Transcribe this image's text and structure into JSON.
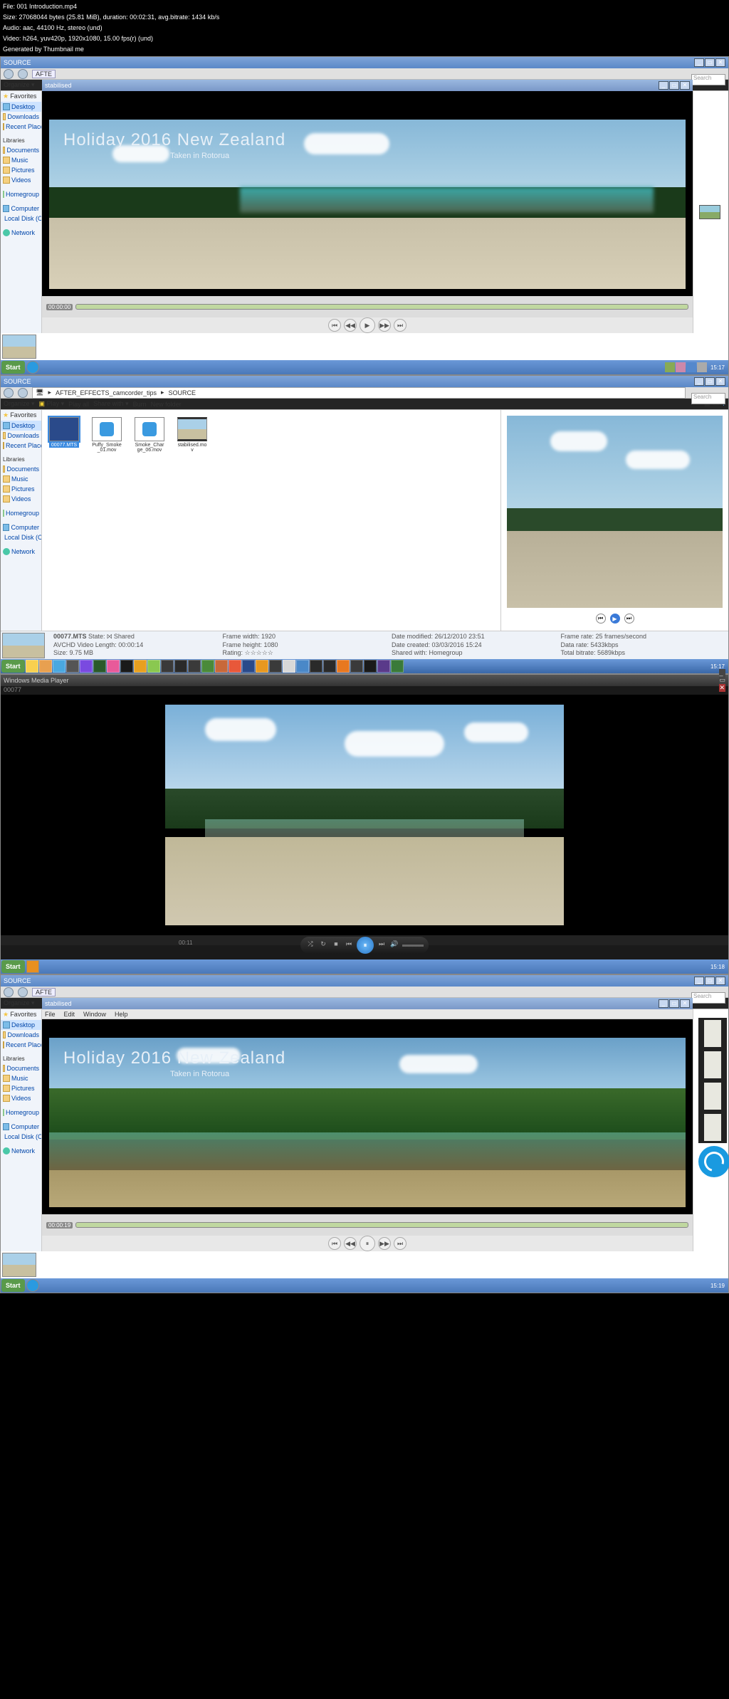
{
  "header": {
    "file": "File: 001 Introduction.mp4",
    "size": "Size: 27068044 bytes (25.81 MiB), duration: 00:02:31, avg.bitrate: 1434 kb/s",
    "audio": "Audio: aac, 44100 Hz, stereo (und)",
    "video": "Video: h264, yuv420p, 1920x1080, 15.00 fps(r) (und)",
    "gen": "Generated by Thumbnail me"
  },
  "sidebar": {
    "favorites": "Favorites",
    "desktop": "Desktop",
    "downloads": "Downloads",
    "recent": "Recent Places",
    "libraries": "Libraries",
    "documents": "Documents",
    "music": "Music",
    "pictures": "Pictures",
    "videos": "Videos",
    "homegroup": "Homegroup",
    "computer": "Computer",
    "localdisk": "Local Disk (C:)",
    "network": "Network"
  },
  "s1": {
    "title": "SOURCE",
    "stabtitle": "stabilised",
    "menu_file": "File",
    "menu_edit": "Edit",
    "menu_window": "Window",
    "menu_help": "Help",
    "afterbadge": "AFTE",
    "organize": "Organize ▾",
    "search": "Search",
    "video_title": "Holiday 2016 New Zealand",
    "video_sub": "Taken in Rotorua",
    "time": "00:00:00",
    "clock": "15:17",
    "start": "Start"
  },
  "s2": {
    "crumbs": [
      "AFTER_EFFECTS_camcorder_tips",
      "SOURCE"
    ],
    "organize": "Organize ▾",
    "play": "Play ▾",
    "playall": "Play all",
    "share": "Share with ▾",
    "burn": "Burn",
    "newfolder": "New folder",
    "files": [
      {
        "name": "00077.MTS",
        "sel": true
      },
      {
        "name": "Puffy_Smoke_01.mov",
        "sel": false
      },
      {
        "name": "Smoke_Charge_06.mov",
        "sel": false
      },
      {
        "name": "stabilised.mov",
        "sel": false
      }
    ],
    "details": {
      "name": "00077.MTS",
      "state": "State: ⨝ Shared",
      "type": "AVCHD Video",
      "length": "Length: 00:00:14",
      "size": "Size: 9.75 MB",
      "fw": "Frame width: 1920",
      "fh": "Frame height: 1080",
      "rating": "Rating:",
      "dm": "Date modified: 26/12/2010 23:51",
      "dc": "Date created: 03/03/2016 15:24",
      "sw": "Shared with: Homegroup",
      "fr": "Frame rate: 25 frames/second",
      "dr": "Data rate: 5433kbps",
      "tb": "Total bitrate: 5689kbps"
    },
    "clock": "15:17"
  },
  "s3": {
    "title": "Windows Media Player",
    "label": "00077",
    "time": "00:11",
    "clock": "15:18",
    "start": "Start"
  },
  "s4": {
    "video_title": "Holiday 2016 New Zealand",
    "video_sub": "Taken in Rotorua",
    "time": "00:00:19",
    "clock": "15:19",
    "start": "Start"
  }
}
